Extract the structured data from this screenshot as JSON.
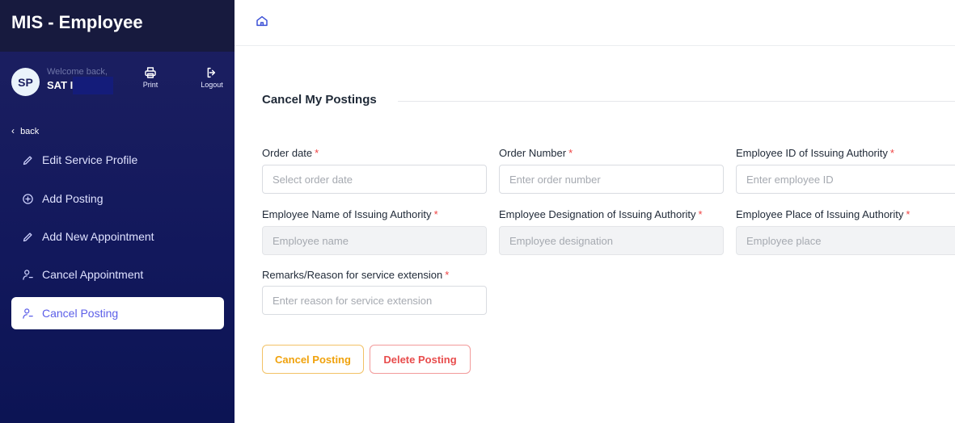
{
  "app": {
    "title": "MIS - Employee"
  },
  "user": {
    "initials": "SP",
    "welcome": "Welcome back,",
    "name": "SAT I"
  },
  "toolbar": {
    "print_label": "Print",
    "logout_label": "Logout"
  },
  "nav": {
    "back_label": "back",
    "items": [
      {
        "label": "Edit Service Profile",
        "icon": "pencil-icon"
      },
      {
        "label": "Add Posting",
        "icon": "plus-circle-icon"
      },
      {
        "label": "Add New Appointment",
        "icon": "pencil-icon"
      },
      {
        "label": "Cancel Appointment",
        "icon": "user-minus-icon"
      },
      {
        "label": "Cancel Posting",
        "icon": "user-minus-icon",
        "active": true
      }
    ]
  },
  "form": {
    "title": "Cancel My Postings",
    "fields": {
      "order_date": {
        "label": "Order date",
        "placeholder": "Select order date",
        "required": "*"
      },
      "order_number": {
        "label": "Order Number",
        "placeholder": "Enter order number",
        "required": "*"
      },
      "employee_id": {
        "label": "Employee ID of Issuing Authority",
        "placeholder": "Enter employee ID",
        "required": "*"
      },
      "employee_name": {
        "label": "Employee Name of Issuing Authority",
        "placeholder": "Employee name",
        "required": "*"
      },
      "employee_designation": {
        "label": "Employee Designation of Issuing Authority",
        "placeholder": "Employee designation",
        "required": "*"
      },
      "employee_place": {
        "label": "Employee Place of Issuing Authority",
        "placeholder": "Employee place",
        "required": "*"
      },
      "remarks": {
        "label": "Remarks/Reason for service extension",
        "placeholder": "Enter reason for service extension",
        "required": "*"
      }
    },
    "buttons": {
      "cancel_posting": "Cancel Posting",
      "delete_posting": "Delete Posting"
    }
  },
  "colors": {
    "sidebar_bg": "#12185c",
    "accent": "#5b5ee8",
    "warning": "#f0a20c",
    "danger": "#e84c4c"
  }
}
